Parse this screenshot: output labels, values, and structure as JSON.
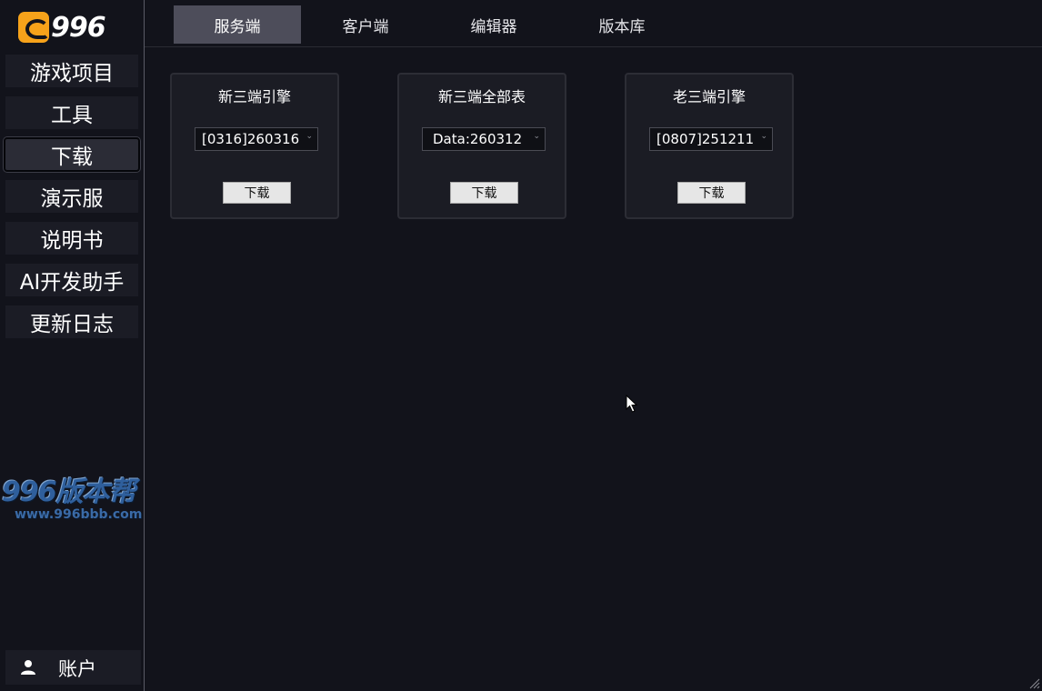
{
  "logo": {
    "text": "996",
    "icon": "dragon-logo-icon",
    "accent": "#f6a21a"
  },
  "sidebar": {
    "items": [
      {
        "label": "游戏项目",
        "active": false
      },
      {
        "label": "工具",
        "active": false
      },
      {
        "label": "下载",
        "active": true
      },
      {
        "label": "演示服",
        "active": false
      },
      {
        "label": "说明书",
        "active": false
      },
      {
        "label": "AI开发助手",
        "active": false
      },
      {
        "label": "更新日志",
        "active": false
      }
    ],
    "account": {
      "label": "账户",
      "icon": "user-icon"
    }
  },
  "watermark": {
    "title": "996版本帮",
    "url": "www.996bbb.com"
  },
  "tabs": [
    {
      "label": "服务端",
      "active": true
    },
    {
      "label": "客户端",
      "active": false
    },
    {
      "label": "编辑器",
      "active": false
    },
    {
      "label": "版本库",
      "active": false
    }
  ],
  "cards": [
    {
      "title": "新三端引擎",
      "selected": "[0316]260316",
      "button": "下载"
    },
    {
      "title": "新三端全部表",
      "selected": "Data:260312",
      "button": "下载"
    },
    {
      "title": "老三端引擎",
      "selected": "[0807]251211",
      "button": "下载"
    }
  ],
  "colors": {
    "background": "#12131b",
    "active_tab": "#4d4d5a",
    "card": "#1b1c24"
  }
}
